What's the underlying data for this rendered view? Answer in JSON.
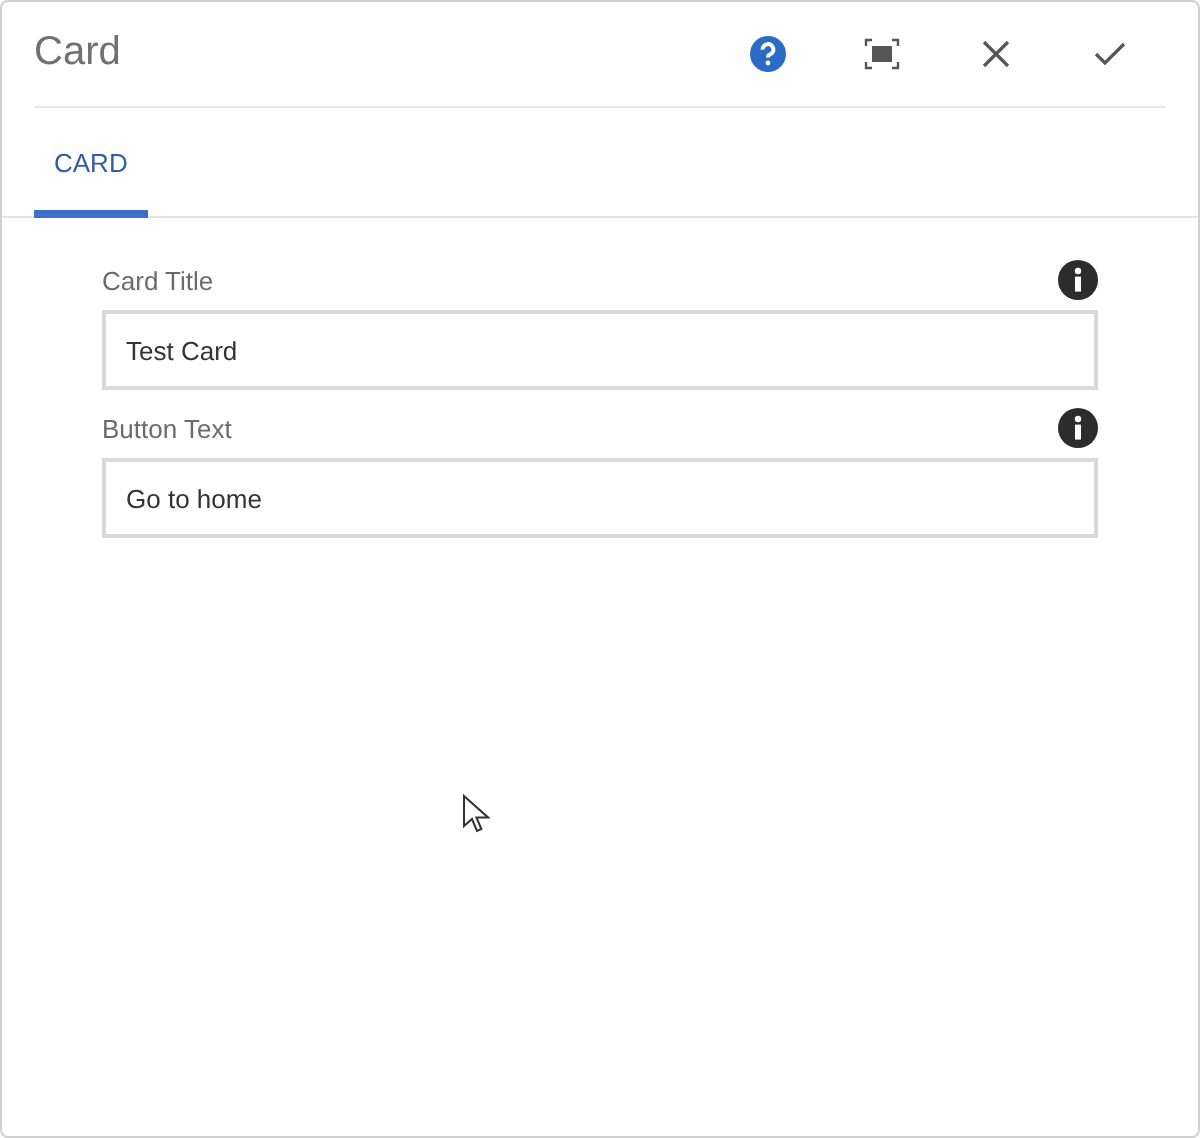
{
  "dialog": {
    "title": "Card"
  },
  "tabs": [
    {
      "label": "CARD",
      "selected": true
    }
  ],
  "fields": [
    {
      "label": "Card Title",
      "value": "Test Card"
    },
    {
      "label": "Button Text",
      "value": "Go to home"
    }
  ]
}
